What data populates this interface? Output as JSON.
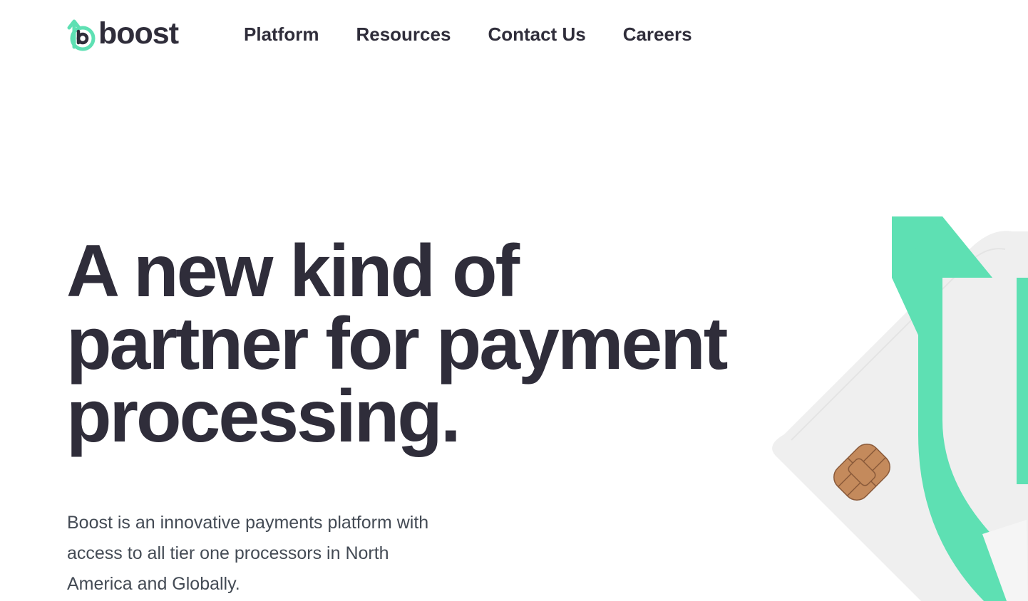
{
  "header": {
    "logo": {
      "text": "boost",
      "icon": "boost-b-arrow-icon",
      "accent_color": "#5ee0b3"
    },
    "nav": [
      {
        "label": "Platform"
      },
      {
        "label": "Resources"
      },
      {
        "label": "Contact Us"
      },
      {
        "label": "Careers"
      }
    ]
  },
  "hero": {
    "headline_line1": "A new kind of",
    "headline_line2": "partner for payment",
    "headline_line3": "processing.",
    "subtext_line1": "Boost is an innovative payments platform with",
    "subtext_line2": "access to all tier one processors in North",
    "subtext_line3": "America and Globally."
  },
  "illustration": {
    "card_icon": "credit-card-with-chip",
    "arrow_icon": "upward-arrow-icon",
    "colors": {
      "arrow": "#5ee0b3",
      "card": "#efefef",
      "chip": "#c48a5c",
      "text": "#2f2d3a"
    }
  }
}
